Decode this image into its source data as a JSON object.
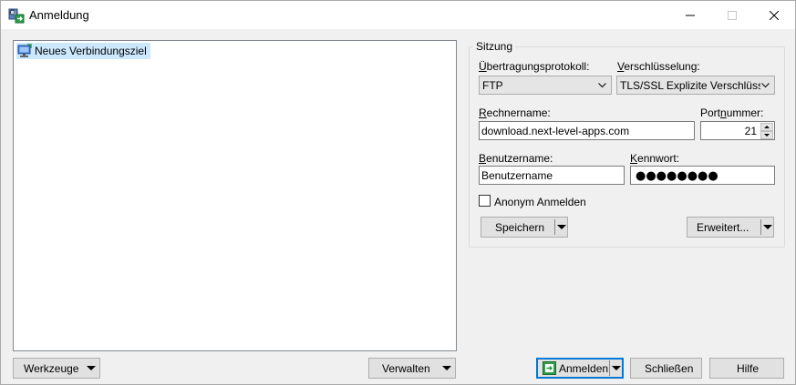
{
  "window": {
    "title": "Anmeldung"
  },
  "tree": {
    "items": [
      {
        "label": "Neues Verbindungsziel",
        "icon": "computer-icon"
      }
    ]
  },
  "session": {
    "group_title": "Sitzung",
    "protocol": {
      "label_pre": "",
      "label_ul": "Ü",
      "label_post": "bertragungsprotokoll:",
      "value": "FTP"
    },
    "encryption": {
      "label_pre": "",
      "label_ul": "V",
      "label_post": "erschlüsselung:",
      "value": "TLS/SSL Explizite Verschlüsselun"
    },
    "host": {
      "label_pre": "",
      "label_ul": "R",
      "label_post": "echnername:",
      "value": "download.next-level-apps.com"
    },
    "port": {
      "label_pre": "Port",
      "label_ul": "n",
      "label_post": "ummer:",
      "value": "21"
    },
    "username": {
      "label_pre": "",
      "label_ul": "B",
      "label_post": "enutzername:",
      "value": "Benutzername"
    },
    "password": {
      "label_pre": "",
      "label_ul": "K",
      "label_post": "ennwort:",
      "masked": "●●●●●●●●"
    },
    "anonymous": {
      "label": "Anonym Anmelden",
      "checked": false
    },
    "save_label": "Speichern",
    "advanced_label": "Erweitert..."
  },
  "footer": {
    "tools_label": "Werkzeuge",
    "manage_label": "Verwalten",
    "login_label": "Anmelden",
    "close_label": "Schließen",
    "help_label": "Hilfe"
  },
  "colors": {
    "selection": "#cce8ff",
    "accent": "#0078d7",
    "login_icon": "#1e9e3a"
  }
}
